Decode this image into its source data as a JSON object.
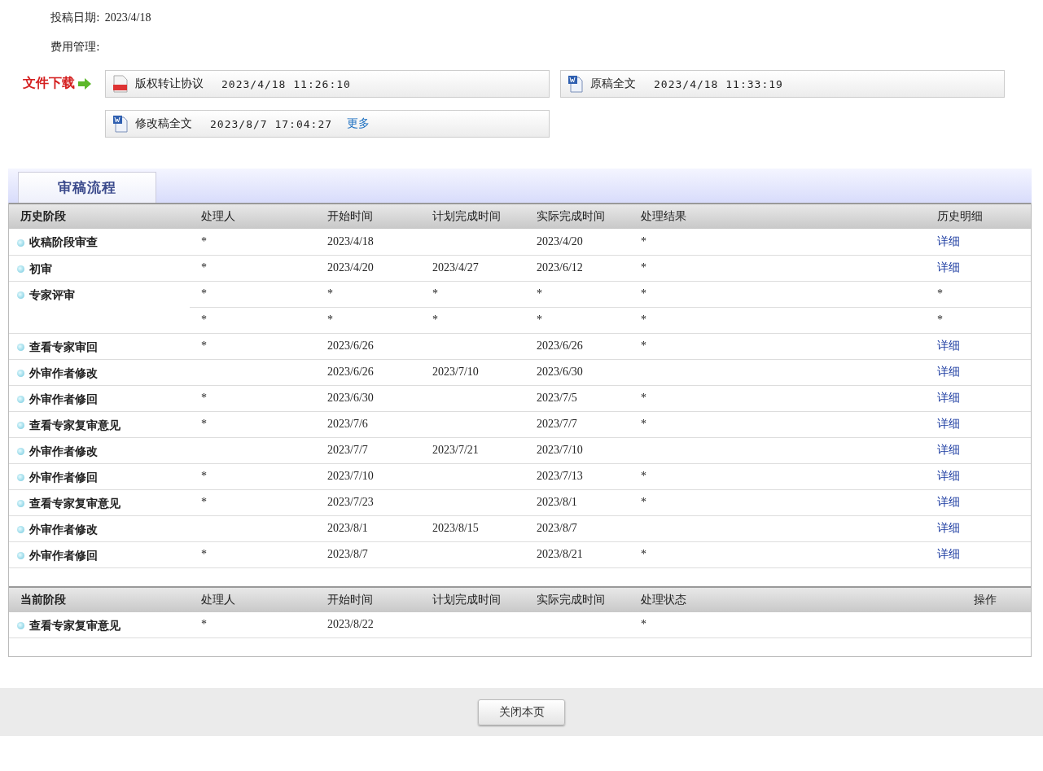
{
  "info": [
    {
      "label": "投稿日期:",
      "value": "2023/4/18"
    },
    {
      "label": "费用管理:"
    }
  ],
  "downloads": {
    "label": "文件下载",
    "files": [
      {
        "kind": "pdf",
        "name": "版权转让协议",
        "time": "2023/4/18 11:26:10"
      },
      {
        "kind": "word",
        "name": "原稿全文",
        "time": "2023/4/18 11:33:19"
      },
      {
        "kind": "word",
        "name": "修改稿全文",
        "time": "2023/8/7 17:04:27",
        "more": "更多"
      }
    ]
  },
  "section_tab": {
    "label": "审稿流程",
    "selected": true
  },
  "history": {
    "columns": [
      "历史阶段",
      "处理人",
      "开始时间",
      "计划完成时间",
      "实际完成时间",
      "处理结果",
      "历史明细"
    ],
    "rows": [
      {
        "stage": "收稿阶段审查",
        "records": [
          {
            "handler": "*",
            "start": "2023/4/18",
            "actual": "2023/4/20",
            "result": "*",
            "detail": {
              "kind": "link",
              "text": "详细"
            }
          }
        ]
      },
      {
        "stage": "初审",
        "records": [
          {
            "handler": "*",
            "start": "2023/4/20",
            "planned": "2023/4/27",
            "actual": "2023/6/12",
            "result": "*",
            "detail": {
              "kind": "link",
              "text": "详细"
            }
          }
        ]
      },
      {
        "stage": "专家评审",
        "records": [
          {
            "handler": "*",
            "start": "*",
            "planned": "*",
            "actual": "*",
            "result": "*",
            "detail": {
              "kind": "text",
              "text": "*"
            }
          },
          {
            "handler": "*",
            "start": "*",
            "planned": "*",
            "actual": "*",
            "result": "*",
            "detail": {
              "kind": "text",
              "text": "*"
            }
          }
        ]
      },
      {
        "stage": "查看专家审回",
        "records": [
          {
            "handler": "*",
            "start": "2023/6/26",
            "actual": "2023/6/26",
            "result": "*",
            "detail": {
              "kind": "link",
              "text": "详细"
            }
          }
        ]
      },
      {
        "stage": "外审作者修改",
        "records": [
          {
            "start": "2023/6/26",
            "planned": "2023/7/10",
            "actual": "2023/6/30",
            "detail": {
              "kind": "link",
              "text": "详细"
            }
          }
        ]
      },
      {
        "stage": "外审作者修回",
        "records": [
          {
            "handler": "*",
            "start": "2023/6/30",
            "actual": "2023/7/5",
            "result": "*",
            "detail": {
              "kind": "link",
              "text": "详细"
            }
          }
        ]
      },
      {
        "stage": "查看专家复审意见",
        "records": [
          {
            "handler": "*",
            "start": "2023/7/6",
            "actual": "2023/7/7",
            "result": "*",
            "detail": {
              "kind": "link",
              "text": "详细"
            }
          }
        ]
      },
      {
        "stage": "外审作者修改",
        "records": [
          {
            "start": "2023/7/7",
            "planned": "2023/7/21",
            "actual": "2023/7/10",
            "detail": {
              "kind": "link",
              "text": "详细"
            }
          }
        ]
      },
      {
        "stage": "外审作者修回",
        "records": [
          {
            "handler": "*",
            "start": "2023/7/10",
            "actual": "2023/7/13",
            "result": "*",
            "detail": {
              "kind": "link",
              "text": "详细"
            }
          }
        ]
      },
      {
        "stage": "查看专家复审意见",
        "records": [
          {
            "handler": "*",
            "start": "2023/7/23",
            "actual": "2023/8/1",
            "result": "*",
            "detail": {
              "kind": "link",
              "text": "详细"
            }
          }
        ]
      },
      {
        "stage": "外审作者修改",
        "records": [
          {
            "start": "2023/8/1",
            "planned": "2023/8/15",
            "actual": "2023/8/7",
            "detail": {
              "kind": "link",
              "text": "详细"
            }
          }
        ]
      },
      {
        "stage": "外审作者修回",
        "records": [
          {
            "handler": "*",
            "start": "2023/8/7",
            "actual": "2023/8/21",
            "result": "*",
            "detail": {
              "kind": "link",
              "text": "详细"
            }
          }
        ]
      }
    ]
  },
  "current": {
    "columns": [
      "当前阶段",
      "处理人",
      "开始时间",
      "计划完成时间",
      "实际完成时间",
      "处理状态",
      "操作"
    ],
    "rows": [
      {
        "stage": "查看专家复审意见",
        "records": [
          {
            "handler": "*",
            "start": "2023/8/22",
            "result": "*"
          }
        ]
      }
    ]
  },
  "close_button": "关闭本页"
}
